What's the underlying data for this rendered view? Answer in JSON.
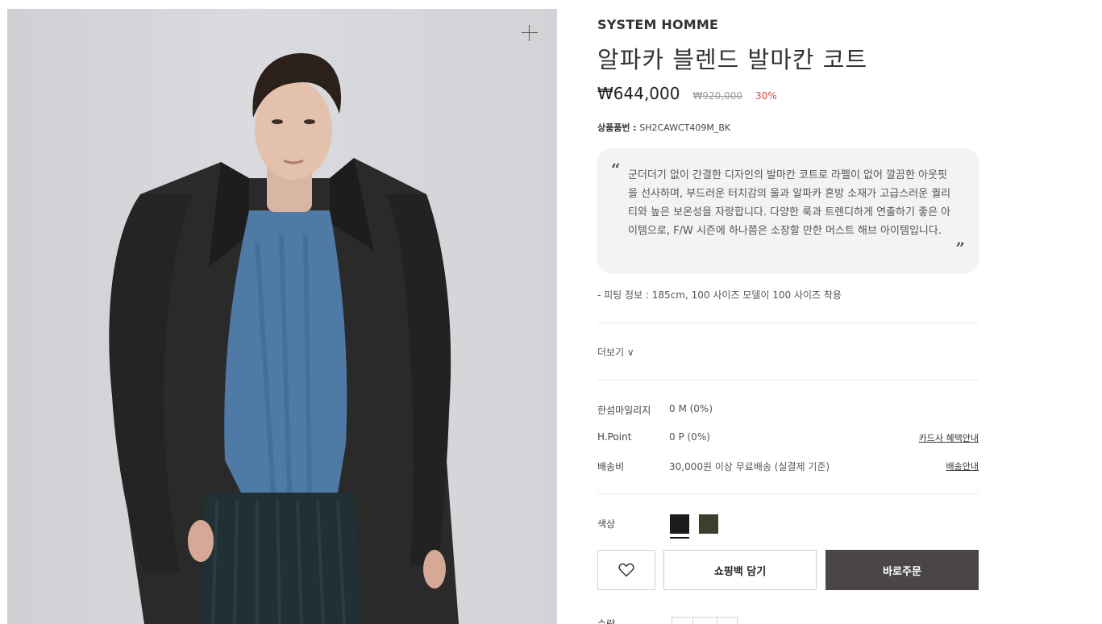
{
  "product": {
    "brand": "SYSTEM HOMME",
    "title": "알파카 블렌드 발마칸 코트",
    "price": "₩644,000",
    "original_price": "₩920,000",
    "discount": "30%",
    "sku_label": "상품품번 :",
    "sku_value": "SH2CAWCT409M_BK",
    "description": "군더더기 없이 간결한 디자인의 발마칸 코트로 라펠이 없어 깔끔한 아웃핏을 선사하며, 부드러운 터치감의 울과 알파카 혼방 소재가 고급스러운 퀄리티와 높은 보온성을 자랑합니다. 다양한 룩과 트렌디하게 연출하기 좋은 아이템으로, F/W 시즌에 하나쯤은 소장할 만한 머스트 해브 아이템입니다.",
    "quote_open": "“",
    "quote_close": "”",
    "fitting_info": "- 피팅 정보 : 185cm, 100 사이즈 모델이 100 사이즈 착용",
    "more_label": "더보기 ∨"
  },
  "benefits": {
    "mileage_label": "한섬마일리지",
    "mileage_value": "0 M (0%)",
    "hpoint_label": "H.Point",
    "hpoint_value": "0 P (0%)",
    "card_link": "카드사 혜택안내",
    "shipping_label": "배송비",
    "shipping_value": "30,000원 이상 무료배송 (실결제 기준)",
    "shipping_link": "배송안내"
  },
  "options": {
    "color_label": "색상",
    "colors": [
      "#1b1c1e",
      "#3d3f2d"
    ],
    "selected_color": "#1b1c1e",
    "qty_label": "수량"
  },
  "actions": {
    "wish_icon": "heart-icon",
    "cart_label": "쇼핑백 담기",
    "buy_label": "바로주문"
  },
  "image": {
    "zoom_icon": "plus-icon"
  }
}
